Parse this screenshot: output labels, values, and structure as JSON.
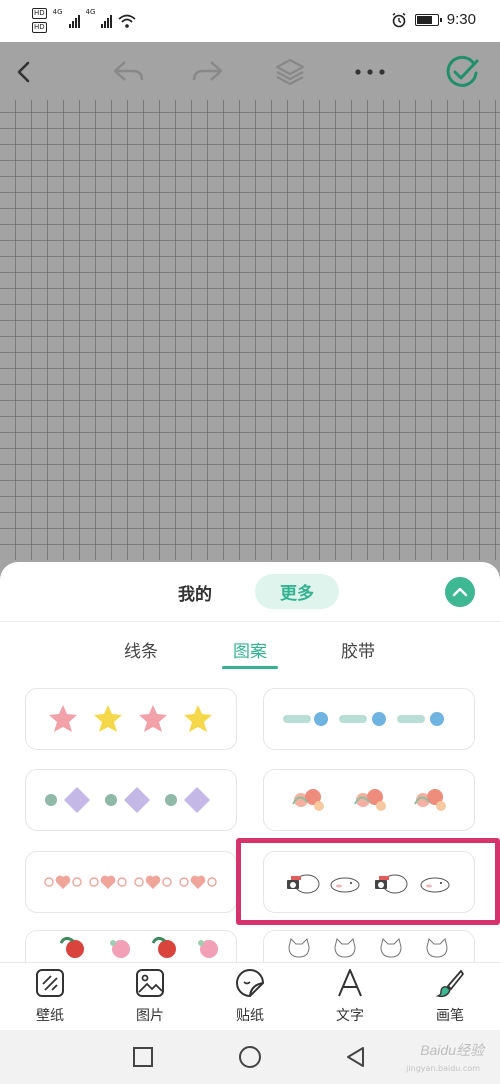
{
  "status_bar": {
    "hd_label": "HD",
    "network_label": "4G",
    "time": "9:30",
    "battery_percent": 80
  },
  "toolbar": {
    "icons": [
      "back-icon",
      "undo-icon",
      "redo-icon",
      "layers-icon",
      "more-icon",
      "confirm-icon"
    ],
    "accent": "#33b392"
  },
  "sheet": {
    "segments": {
      "mine": "我的",
      "more": "更多"
    },
    "tabs": [
      {
        "label": "线条"
      },
      {
        "label": "图案"
      },
      {
        "label": "胶带"
      }
    ],
    "active_tab": "图案",
    "patterns": [
      {
        "name": "star-pattern"
      },
      {
        "name": "dash-dot-pattern"
      },
      {
        "name": "circle-diamond-pattern"
      },
      {
        "name": "floral-pattern"
      },
      {
        "name": "heart-swirl-pattern"
      },
      {
        "name": "cat-camera-pattern"
      },
      {
        "name": "fruit-pattern"
      },
      {
        "name": "cat-face-pattern"
      }
    ],
    "highlight_color": "#d6336c"
  },
  "bottom_nav": {
    "items": [
      {
        "label": "壁纸",
        "icon": "wallpaper-icon"
      },
      {
        "label": "图片",
        "icon": "image-icon"
      },
      {
        "label": "贴纸",
        "icon": "sticker-icon"
      },
      {
        "label": "文字",
        "icon": "text-icon"
      },
      {
        "label": "画笔",
        "icon": "brush-icon"
      }
    ]
  },
  "system_nav": {
    "icons": [
      "recent-apps-icon",
      "home-icon",
      "back-triangle-icon"
    ],
    "watermark": "Baidu经验",
    "watermark_sub": "jingyan.baidu.com"
  }
}
